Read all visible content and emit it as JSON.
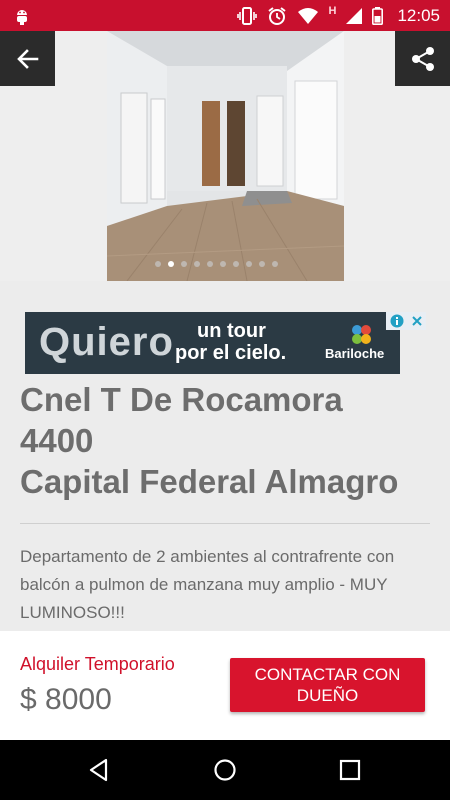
{
  "status_bar": {
    "time": "12:05",
    "network_badge": "H",
    "icons": [
      "android-debug-icon",
      "vibrate-icon",
      "alarm-icon",
      "wifi-icon",
      "signal-icon",
      "battery-icon"
    ]
  },
  "gallery": {
    "image_count": 10,
    "active_index": 1,
    "back_icon": "arrow-back-icon",
    "share_icon": "share-icon"
  },
  "ad": {
    "brand": "Quiero",
    "tagline_line1": "un tour",
    "tagline_line2": "por el cielo.",
    "logo_text": "Bariloche"
  },
  "listing": {
    "title_line1": "Cnel T De Rocamora",
    "title_line2": "4400",
    "title_line3": "Capital Federal Almagro",
    "description": "Departamento de 2 ambientes al contrafrente con balcón a pulmon de manzana muy amplio - MUY LUMINOSO!!!"
  },
  "footer": {
    "price_label": "Alquiler Temporario",
    "price": "$ 8000",
    "contact_button": "CONTACTAR CON DUEÑO"
  },
  "colors": {
    "brand_red": "#c8102e",
    "button_red": "#d8142d",
    "text_gray": "#6d6d6d"
  }
}
